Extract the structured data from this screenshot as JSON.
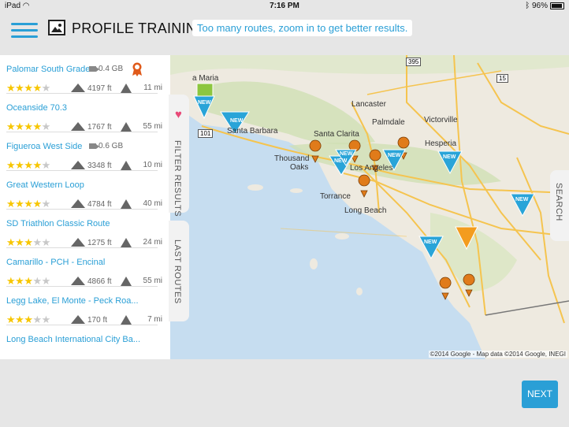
{
  "status_bar": {
    "carrier": "iPad",
    "time": "7:16 PM",
    "battery": "96%"
  },
  "header": {
    "title": "PROFILE TRAINING",
    "notice": "Too many routes, zoom in to get better results."
  },
  "routes": [
    {
      "name": "Palomar South Grade",
      "video": "0.4 GB",
      "stars": 4,
      "elevation": "4197 ft",
      "distance": "11 mi",
      "badge": true
    },
    {
      "name": "Oceanside 70.3",
      "video": "",
      "stars": 4,
      "elevation": "1767 ft",
      "distance": "55 mi",
      "badge": false
    },
    {
      "name": "Figueroa West Side",
      "video": "0.6 GB",
      "stars": 4,
      "elevation": "3348 ft",
      "distance": "10 mi",
      "badge": false
    },
    {
      "name": "Great Western Loop",
      "video": "",
      "stars": 4,
      "elevation": "4784 ft",
      "distance": "40 mi",
      "badge": false
    },
    {
      "name": "SD Triathlon Classic Route",
      "video": "",
      "stars": 3,
      "elevation": "1275 ft",
      "distance": "24 mi",
      "badge": false
    },
    {
      "name": "Camarillo - PCH - Encinal",
      "video": "",
      "stars": 3,
      "elevation": "4866 ft",
      "distance": "55 mi",
      "badge": false
    },
    {
      "name": "Legg Lake, El Monte - Peck Roa...",
      "video": "",
      "stars": 3,
      "elevation": "170 ft",
      "distance": "7 mi",
      "badge": false
    },
    {
      "name": "Long Beach International City Ba...",
      "video": "",
      "stars": 0,
      "elevation": "",
      "distance": "",
      "badge": false
    }
  ],
  "tabs": {
    "filter": "FILTER RESULTS",
    "last": "LAST ROUTES",
    "search": "SEARCH"
  },
  "map": {
    "places": [
      "Lancaster",
      "Palmdale",
      "Victorville",
      "Hesperia",
      "Santa Clarita",
      "Santa Barbara",
      "Thousand",
      "Oaks",
      "Los Angeles",
      "Torrance",
      "Long Beach",
      "a Maria"
    ],
    "shields": [
      "395",
      "15",
      "101"
    ],
    "new_label": "NEW",
    "copyright": "©2014 Google - Map data ©2014 Google, INEGI"
  },
  "buttons": {
    "next": "NEXT"
  },
  "colors": {
    "accent": "#2a9fd6",
    "star": "#f7c600",
    "pin": "#e07b1a",
    "new_marker": "#29a4d8"
  }
}
